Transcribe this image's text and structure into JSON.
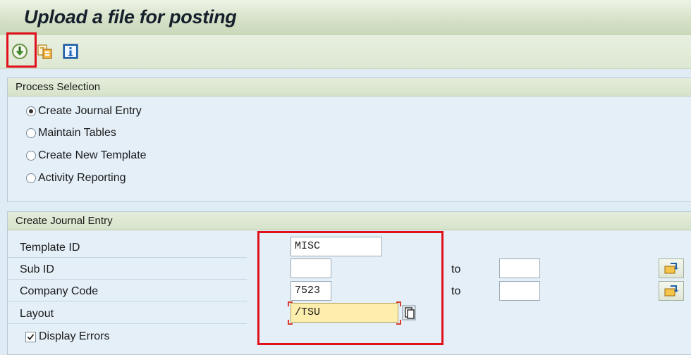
{
  "page": {
    "title": "Upload a file for posting"
  },
  "toolbar": {
    "icons": [
      "execute-icon",
      "get-variant-icon",
      "info-icon"
    ]
  },
  "process_selection": {
    "header": "Process Selection",
    "options": [
      {
        "label": "Create Journal Entry",
        "selected": true
      },
      {
        "label": "Maintain Tables",
        "selected": false
      },
      {
        "label": "Create New Template",
        "selected": false
      },
      {
        "label": "Activity Reporting",
        "selected": false
      }
    ]
  },
  "create_journal_entry": {
    "header": "Create Journal Entry",
    "fields": {
      "template_id": {
        "label": "Template ID",
        "value": "MISC"
      },
      "sub_id": {
        "label": "Sub ID",
        "value": "",
        "to_label": "to",
        "to_value": ""
      },
      "company_code": {
        "label": "Company Code",
        "value": "7523",
        "to_label": "to",
        "to_value": ""
      },
      "layout": {
        "label": "Layout",
        "value": "/TSU"
      }
    },
    "display_errors": {
      "label": "Display Errors",
      "checked": true
    }
  },
  "colors": {
    "highlight": "#e0101c",
    "focused_field": "#fdeeae",
    "background": "#dfebf5"
  }
}
